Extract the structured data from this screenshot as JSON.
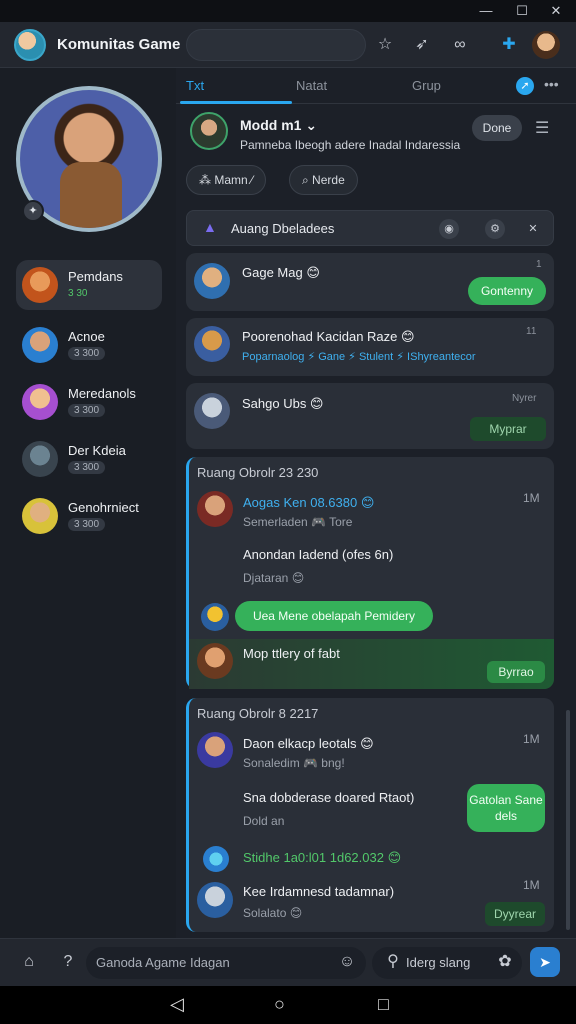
{
  "window": {
    "minimize": "—",
    "maximize": "☐",
    "close": "✕"
  },
  "header": {
    "title": "Komunitas Game",
    "icons": [
      "star-icon",
      "rocket-icon",
      "controller-icon",
      "puzzle-icon"
    ]
  },
  "sidebar": {
    "items": [
      {
        "name": "Pemdans",
        "count": "3 30",
        "active": true
      },
      {
        "name": "Acnoe",
        "count": "3 300"
      },
      {
        "name": "Meredanols",
        "count": "3 300"
      },
      {
        "name": "Der Kdeia",
        "count": "3 300"
      },
      {
        "name": "Genohrniect",
        "count": "3 300"
      }
    ]
  },
  "tabs": [
    {
      "label": "Txt",
      "active": true
    },
    {
      "label": "Natat"
    },
    {
      "label": "Grup"
    }
  ],
  "profile": {
    "name": "Modd m1 ⌄",
    "subtitle": "Pamneba Ibeogh adere Inadal Indaressia",
    "done_label": "Done",
    "chips": [
      "⁂ Mamn ⁄",
      "⌕ Nerde"
    ]
  },
  "room_bar": {
    "label": "Auang Dbeladees"
  },
  "cards": [
    {
      "title": "Gage Mag 😊",
      "time": "1",
      "button": "Gontenny"
    },
    {
      "title": "Poorenohad Kacidan Raze 😊",
      "time": "11",
      "tags": "Poparnaolog ⚡ Gane ⚡ Stulent ⚡ IShyreantecor"
    },
    {
      "title": "Sahgo Ubs 😊",
      "time": "Nyrer",
      "button": "Myprar"
    }
  ],
  "threads": [
    {
      "head": "Ruang Obrolr 23 230",
      "rows": [
        {
          "name": "Aogas Ken 08.6380 😊",
          "sub": "Semerladen 🎮 Tore",
          "time": "1M"
        },
        {
          "name": "Anondan Iadend (ofes 6n)",
          "sub": "Djataran 😊"
        },
        {
          "pill": "Uea Mene obelapah Pemidery"
        },
        {
          "name": "Mop ttlery of fabt",
          "action": "Byrrao"
        }
      ]
    },
    {
      "head": "Ruang Obrolr 8 2217",
      "rows": [
        {
          "name": "Daon elkacp leotals 😊",
          "sub": "Sonaledim 🎮 bng!",
          "time": "1M"
        },
        {
          "name": "Sna dobderase doared Rtaot)",
          "sub": "Dold an",
          "button": "Gatolan Sane dels"
        },
        {
          "name": "Stidhe 1a0:l01 1d62.032 😊"
        },
        {
          "name": "Kee Irdamnesd tadamnar)",
          "sub": "Solalato 😊",
          "time": "1M",
          "action": "Dyyrear"
        }
      ]
    }
  ],
  "composer": {
    "placeholder": "Ganoda Agame Idagan",
    "slang": "Iderg slang"
  },
  "navbar": {
    "back": "◁",
    "home": "○",
    "recent": "□"
  },
  "colors": {
    "accent": "#2aa7ef",
    "green": "#35b15a",
    "bg": "#1c2028"
  }
}
